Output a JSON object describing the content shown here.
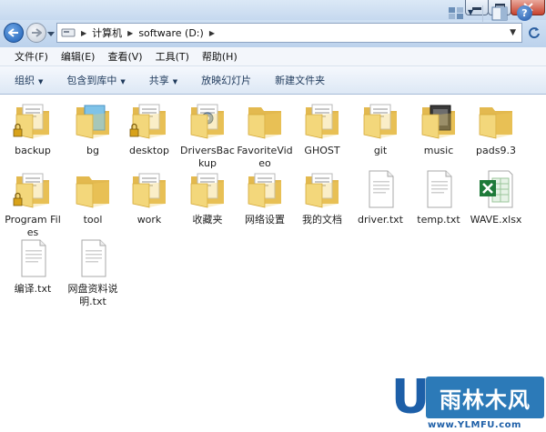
{
  "address": {
    "crumbs": [
      "计算机",
      "software (D:)"
    ]
  },
  "menu": [
    "文件(F)",
    "编辑(E)",
    "查看(V)",
    "工具(T)",
    "帮助(H)"
  ],
  "toolbar": {
    "organize": "组织",
    "include_library": "包含到库中",
    "share": "共享",
    "slideshow": "放映幻灯片",
    "new_folder": "新建文件夹",
    "help": "?"
  },
  "items": [
    {
      "label": "backup",
      "type": "folder-locked"
    },
    {
      "label": "bg",
      "type": "folder-blue"
    },
    {
      "label": "desktop",
      "type": "folder-locked"
    },
    {
      "label": "DriversBackup",
      "type": "folder-gear"
    },
    {
      "label": "FavoriteVideo",
      "type": "folder"
    },
    {
      "label": "GHOST",
      "type": "folder-doc"
    },
    {
      "label": "git",
      "type": "folder-doc"
    },
    {
      "label": "music",
      "type": "folder-dark"
    },
    {
      "label": "pads9.3",
      "type": "folder"
    },
    {
      "label": "Program Files",
      "type": "folder-locked"
    },
    {
      "label": "tool",
      "type": "folder"
    },
    {
      "label": "work",
      "type": "folder-doc"
    },
    {
      "label": "收藏夹",
      "type": "folder-doc"
    },
    {
      "label": "网络设置",
      "type": "folder-doc"
    },
    {
      "label": "我的文档",
      "type": "folder-doc"
    },
    {
      "label": "driver.txt",
      "type": "txt"
    },
    {
      "label": "temp.txt",
      "type": "txt"
    },
    {
      "label": "WAVE.xlsx",
      "type": "xlsx"
    },
    {
      "label": "编译.txt",
      "type": "txt"
    },
    {
      "label": "网盘资料说明.txt",
      "type": "txt"
    }
  ],
  "watermark": {
    "letter": "U",
    "brand": "雨林木风",
    "url": "www.YLMFU.com"
  }
}
